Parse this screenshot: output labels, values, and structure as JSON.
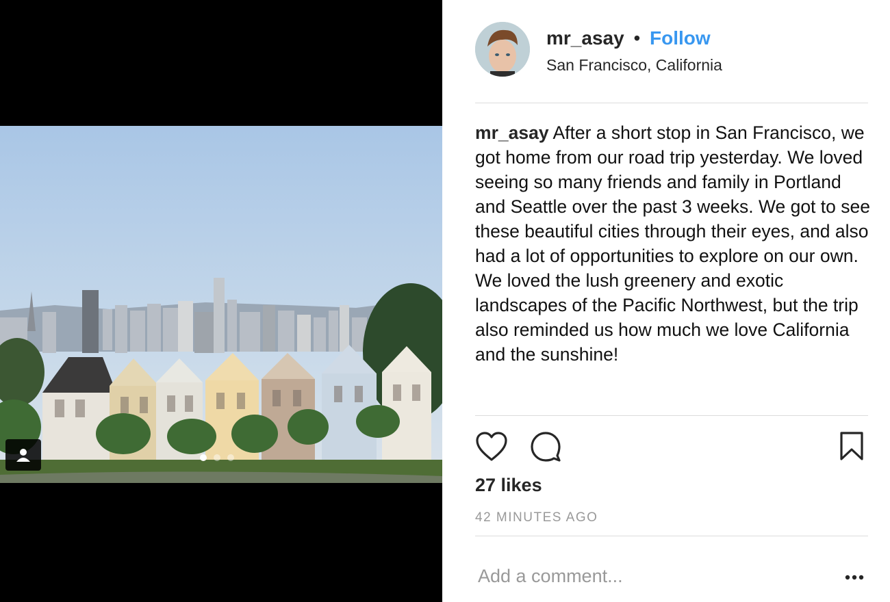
{
  "post": {
    "username": "mr_asay",
    "separator": "•",
    "follow_label": "Follow",
    "location": "San Francisco, California",
    "caption_user": "mr_asay",
    "caption_text_1": "After a short stop in San Francisco, we got home from our road trip yesterday. We loved seeing so many friends and family in Portland and Seattle over the past 3 weeks. We got to see these beautiful cities through their eyes, and also had a lot of opportunities to explore on our own.",
    "caption_text_2": "We loved the lush greenery and exotic landscapes of the Pacific Northwest, but the trip also reminded us how much we love California and the sunshine!",
    "likes": "27 likes",
    "timestamp": "42 MINUTES AGO"
  },
  "comment": {
    "placeholder": "Add a comment..."
  },
  "carousel": {
    "slides": 3,
    "active_index": 0
  },
  "icons": {
    "like": "heart-icon",
    "comment": "comment-bubble-icon",
    "save": "bookmark-icon",
    "more": "more-options-icon",
    "tag": "user-tag-icon"
  },
  "colors": {
    "accent": "#3897f0",
    "muted": "#999999",
    "divider": "#dbdbdb"
  }
}
